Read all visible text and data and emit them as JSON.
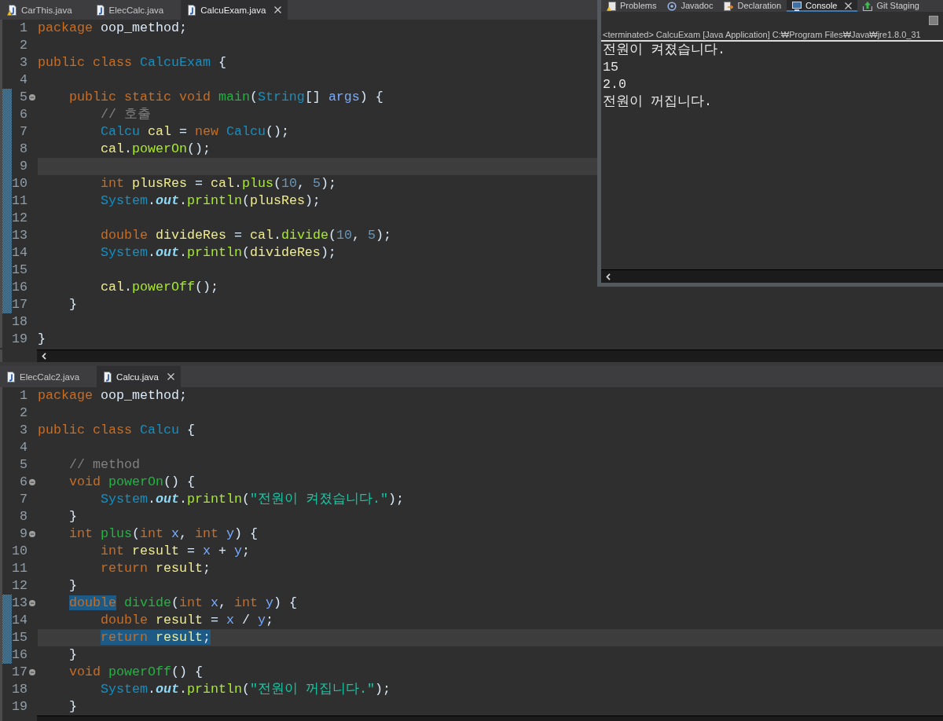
{
  "editors": [
    {
      "tabs": [
        {
          "label": "CarThis.java",
          "selected": false,
          "warning": true
        },
        {
          "label": "ElecCalc.java",
          "selected": false,
          "warning": false
        },
        {
          "label": "CalcuExam.java",
          "selected": true,
          "warning": false
        }
      ],
      "lines": [
        {
          "number": "1",
          "current": false,
          "changed": false,
          "foldable": false,
          "tokens": [
            {
              "kind": "keyword",
              "text": "package",
              "marked": false
            },
            {
              "kind": "plain",
              "text": " oop_method;",
              "marked": false
            }
          ]
        },
        {
          "number": "2",
          "current": false,
          "changed": false,
          "foldable": false
        },
        {
          "number": "3",
          "current": false,
          "changed": false,
          "foldable": false,
          "tokens": [
            {
              "kind": "keyword",
              "text": "public class",
              "marked": false
            },
            {
              "kind": "type",
              "text": " CalcuExam",
              "marked": false
            },
            {
              "kind": "plain",
              "text": " {",
              "marked": false
            }
          ]
        },
        {
          "number": "4",
          "current": false,
          "changed": false,
          "foldable": false
        },
        {
          "number": "5",
          "current": false,
          "changed": true,
          "foldable": true,
          "tokens": [
            {
              "kind": "keyword",
              "text": "    public static void",
              "marked": false
            },
            {
              "kind": "declaration",
              "text": " main",
              "marked": false
            },
            {
              "kind": "plain",
              "text": "(",
              "marked": false
            },
            {
              "kind": "type",
              "text": "String",
              "marked": false
            },
            {
              "kind": "plain",
              "text": "[] ",
              "marked": false
            },
            {
              "kind": "parameter",
              "text": "args",
              "marked": false
            },
            {
              "kind": "plain",
              "text": ") {",
              "marked": false
            }
          ]
        },
        {
          "number": "6",
          "current": false,
          "changed": true,
          "foldable": false,
          "tokens": [
            {
              "kind": "comment",
              "text": "        // 호출",
              "marked": false
            }
          ]
        },
        {
          "number": "7",
          "current": false,
          "changed": true,
          "foldable": false,
          "tokens": [
            {
              "kind": "type",
              "text": "        Calcu",
              "marked": false
            },
            {
              "kind": "variable",
              "text": " cal",
              "marked": false
            },
            {
              "kind": "plain",
              "text": " = ",
              "marked": false
            },
            {
              "kind": "keyword",
              "text": "new",
              "marked": false
            },
            {
              "kind": "type",
              "text": " Calcu",
              "marked": false
            },
            {
              "kind": "plain",
              "text": "();",
              "marked": false
            }
          ]
        },
        {
          "number": "8",
          "current": false,
          "changed": true,
          "foldable": false,
          "tokens": [
            {
              "kind": "variable",
              "text": "        cal",
              "marked": false
            },
            {
              "kind": "plain",
              "text": ".",
              "marked": false
            },
            {
              "kind": "call",
              "text": "powerOn",
              "marked": false
            },
            {
              "kind": "plain",
              "text": "();",
              "marked": false
            }
          ]
        },
        {
          "number": "9",
          "current": true,
          "changed": true,
          "foldable": false
        },
        {
          "number": "10",
          "current": false,
          "changed": true,
          "foldable": false,
          "tokens": [
            {
              "kind": "keyword",
              "text": "        int",
              "marked": false
            },
            {
              "kind": "variable",
              "text": " plusRes",
              "marked": false
            },
            {
              "kind": "plain",
              "text": " = ",
              "marked": false
            },
            {
              "kind": "variable",
              "text": "cal",
              "marked": false
            },
            {
              "kind": "plain",
              "text": ".",
              "marked": false
            },
            {
              "kind": "call",
              "text": "plus",
              "marked": false
            },
            {
              "kind": "plain",
              "text": "(",
              "marked": false
            },
            {
              "kind": "number",
              "text": "10",
              "marked": false
            },
            {
              "kind": "plain",
              "text": ", ",
              "marked": false
            },
            {
              "kind": "number",
              "text": "5",
              "marked": false
            },
            {
              "kind": "plain",
              "text": ");",
              "marked": false
            }
          ]
        },
        {
          "number": "11",
          "current": false,
          "changed": true,
          "foldable": false,
          "tokens": [
            {
              "kind": "type",
              "text": "        System",
              "marked": false
            },
            {
              "kind": "plain",
              "text": ".",
              "marked": false
            },
            {
              "kind": "field",
              "text": "out",
              "marked": false
            },
            {
              "kind": "plain",
              "text": ".",
              "marked": false
            },
            {
              "kind": "call",
              "text": "println",
              "marked": false
            },
            {
              "kind": "plain",
              "text": "(",
              "marked": false
            },
            {
              "kind": "variable",
              "text": "plusRes",
              "marked": false
            },
            {
              "kind": "plain",
              "text": ");",
              "marked": false
            }
          ]
        },
        {
          "number": "12",
          "current": false,
          "changed": true,
          "foldable": false
        },
        {
          "number": "13",
          "current": false,
          "changed": true,
          "foldable": false,
          "tokens": [
            {
              "kind": "keyword",
              "text": "        double",
              "marked": false
            },
            {
              "kind": "variable",
              "text": " divideRes",
              "marked": false
            },
            {
              "kind": "plain",
              "text": " = ",
              "marked": false
            },
            {
              "kind": "variable",
              "text": "cal",
              "marked": false
            },
            {
              "kind": "plain",
              "text": ".",
              "marked": false
            },
            {
              "kind": "call",
              "text": "divide",
              "marked": false
            },
            {
              "kind": "plain",
              "text": "(",
              "marked": false
            },
            {
              "kind": "number",
              "text": "10",
              "marked": false
            },
            {
              "kind": "plain",
              "text": ", ",
              "marked": false
            },
            {
              "kind": "number",
              "text": "5",
              "marked": false
            },
            {
              "kind": "plain",
              "text": ");",
              "marked": false
            }
          ]
        },
        {
          "number": "14",
          "current": false,
          "changed": true,
          "foldable": false,
          "tokens": [
            {
              "kind": "type",
              "text": "        System",
              "marked": false
            },
            {
              "kind": "plain",
              "text": ".",
              "marked": false
            },
            {
              "kind": "field",
              "text": "out",
              "marked": false
            },
            {
              "kind": "plain",
              "text": ".",
              "marked": false
            },
            {
              "kind": "call",
              "text": "println",
              "marked": false
            },
            {
              "kind": "plain",
              "text": "(",
              "marked": false
            },
            {
              "kind": "variable",
              "text": "divideRes",
              "marked": false
            },
            {
              "kind": "plain",
              "text": ");",
              "marked": false
            }
          ]
        },
        {
          "number": "15",
          "current": false,
          "changed": true,
          "foldable": false
        },
        {
          "number": "16",
          "current": false,
          "changed": true,
          "foldable": false,
          "tokens": [
            {
              "kind": "variable",
              "text": "        cal",
              "marked": false
            },
            {
              "kind": "plain",
              "text": ".",
              "marked": false
            },
            {
              "kind": "call",
              "text": "powerOff",
              "marked": false
            },
            {
              "kind": "plain",
              "text": "();",
              "marked": false
            }
          ]
        },
        {
          "number": "17",
          "current": false,
          "changed": true,
          "foldable": false,
          "tokens": [
            {
              "kind": "plain",
              "text": "    }",
              "marked": false
            }
          ]
        },
        {
          "number": "18",
          "current": false,
          "changed": false,
          "foldable": false
        },
        {
          "number": "19",
          "current": false,
          "changed": false,
          "foldable": false,
          "tokens": [
            {
              "kind": "plain",
              "text": "}",
              "marked": false
            }
          ]
        }
      ]
    },
    {
      "tabs": [
        {
          "label": "ElecCalc2.java",
          "selected": false,
          "warning": false
        },
        {
          "label": "Calcu.java",
          "selected": true,
          "warning": false
        }
      ],
      "lines": [
        {
          "number": "1",
          "current": false,
          "changed": false,
          "foldable": false,
          "tokens": [
            {
              "kind": "keyword",
              "text": "package",
              "marked": false
            },
            {
              "kind": "plain",
              "text": " oop_method;",
              "marked": false
            }
          ]
        },
        {
          "number": "2",
          "current": false,
          "changed": false,
          "foldable": false
        },
        {
          "number": "3",
          "current": false,
          "changed": false,
          "foldable": false,
          "tokens": [
            {
              "kind": "keyword",
              "text": "public class",
              "marked": false
            },
            {
              "kind": "type",
              "text": " Calcu",
              "marked": false
            },
            {
              "kind": "plain",
              "text": " {",
              "marked": false
            }
          ]
        },
        {
          "number": "4",
          "current": false,
          "changed": false,
          "foldable": false
        },
        {
          "number": "5",
          "current": false,
          "changed": false,
          "foldable": false,
          "tokens": [
            {
              "kind": "comment",
              "text": "    // method",
              "marked": false
            }
          ]
        },
        {
          "number": "6",
          "current": false,
          "changed": false,
          "foldable": true,
          "tokens": [
            {
              "kind": "keyword",
              "text": "    void",
              "marked": false
            },
            {
              "kind": "declaration",
              "text": " powerOn",
              "marked": false
            },
            {
              "kind": "plain",
              "text": "() {",
              "marked": false
            }
          ]
        },
        {
          "number": "7",
          "current": false,
          "changed": false,
          "foldable": false,
          "tokens": [
            {
              "kind": "type",
              "text": "        System",
              "marked": false
            },
            {
              "kind": "plain",
              "text": ".",
              "marked": false
            },
            {
              "kind": "field",
              "text": "out",
              "marked": false
            },
            {
              "kind": "plain",
              "text": ".",
              "marked": false
            },
            {
              "kind": "call",
              "text": "println",
              "marked": false
            },
            {
              "kind": "plain",
              "text": "(",
              "marked": false
            },
            {
              "kind": "string",
              "text": "\"전원이 켜졌습니다.\"",
              "marked": false
            },
            {
              "kind": "plain",
              "text": ");",
              "marked": false
            }
          ]
        },
        {
          "number": "8",
          "current": false,
          "changed": false,
          "foldable": false,
          "tokens": [
            {
              "kind": "plain",
              "text": "    }",
              "marked": false
            }
          ]
        },
        {
          "number": "9",
          "current": false,
          "changed": false,
          "foldable": true,
          "tokens": [
            {
              "kind": "keyword",
              "text": "    int",
              "marked": false
            },
            {
              "kind": "declaration",
              "text": " plus",
              "marked": false
            },
            {
              "kind": "plain",
              "text": "(",
              "marked": false
            },
            {
              "kind": "keyword",
              "text": "int",
              "marked": false
            },
            {
              "kind": "parameter",
              "text": " x",
              "marked": false
            },
            {
              "kind": "plain",
              "text": ", ",
              "marked": false
            },
            {
              "kind": "keyword",
              "text": "int",
              "marked": false
            },
            {
              "kind": "parameter",
              "text": " y",
              "marked": false
            },
            {
              "kind": "plain",
              "text": ") {",
              "marked": false
            }
          ]
        },
        {
          "number": "10",
          "current": false,
          "changed": false,
          "foldable": false,
          "tokens": [
            {
              "kind": "keyword",
              "text": "        int",
              "marked": false
            },
            {
              "kind": "variable",
              "text": " result",
              "marked": false
            },
            {
              "kind": "plain",
              "text": " = ",
              "marked": false
            },
            {
              "kind": "parameter",
              "text": "x",
              "marked": false
            },
            {
              "kind": "plain",
              "text": " + ",
              "marked": false
            },
            {
              "kind": "parameter",
              "text": "y",
              "marked": false
            },
            {
              "kind": "plain",
              "text": ";",
              "marked": false
            }
          ]
        },
        {
          "number": "11",
          "current": false,
          "changed": false,
          "foldable": false,
          "tokens": [
            {
              "kind": "keyword",
              "text": "        return",
              "marked": false
            },
            {
              "kind": "variable",
              "text": " result",
              "marked": false
            },
            {
              "kind": "plain",
              "text": ";",
              "marked": false
            }
          ]
        },
        {
          "number": "12",
          "current": false,
          "changed": false,
          "foldable": false,
          "tokens": [
            {
              "kind": "plain",
              "text": "    }",
              "marked": false
            }
          ]
        },
        {
          "number": "13",
          "current": false,
          "changed": true,
          "foldable": true,
          "tokens": [
            {
              "kind": "keyword",
              "text": "    double",
              "marked": true
            },
            {
              "kind": "declaration",
              "text": " divide",
              "marked": false
            },
            {
              "kind": "plain",
              "text": "(",
              "marked": false
            },
            {
              "kind": "keyword",
              "text": "int",
              "marked": false
            },
            {
              "kind": "parameter",
              "text": " x",
              "marked": false
            },
            {
              "kind": "plain",
              "text": ", ",
              "marked": false
            },
            {
              "kind": "keyword",
              "text": "int",
              "marked": false
            },
            {
              "kind": "parameter",
              "text": " y",
              "marked": false
            },
            {
              "kind": "plain",
              "text": ") {",
              "marked": false
            }
          ]
        },
        {
          "number": "14",
          "current": false,
          "changed": true,
          "foldable": false,
          "tokens": [
            {
              "kind": "keyword",
              "text": "        double",
              "marked": false
            },
            {
              "kind": "variable",
              "text": " result",
              "marked": false
            },
            {
              "kind": "plain",
              "text": " = ",
              "marked": false
            },
            {
              "kind": "parameter",
              "text": "x",
              "marked": false
            },
            {
              "kind": "plain",
              "text": " / ",
              "marked": false
            },
            {
              "kind": "parameter",
              "text": "y",
              "marked": false
            },
            {
              "kind": "plain",
              "text": ";",
              "marked": false
            }
          ]
        },
        {
          "number": "15",
          "current": true,
          "changed": true,
          "foldable": false,
          "tokens": [
            {
              "kind": "keyword",
              "text": "        return",
              "marked": true
            },
            {
              "kind": "variable",
              "text": " result",
              "marked": true
            },
            {
              "kind": "plain",
              "text": ";",
              "marked": true
            }
          ]
        },
        {
          "number": "16",
          "current": false,
          "changed": true,
          "foldable": false,
          "tokens": [
            {
              "kind": "plain",
              "text": "    }",
              "marked": false
            }
          ]
        },
        {
          "number": "17",
          "current": false,
          "changed": false,
          "foldable": true,
          "tokens": [
            {
              "kind": "keyword",
              "text": "    void",
              "marked": false
            },
            {
              "kind": "declaration",
              "text": " powerOff",
              "marked": false
            },
            {
              "kind": "plain",
              "text": "() {",
              "marked": false
            }
          ]
        },
        {
          "number": "18",
          "current": false,
          "changed": false,
          "foldable": false,
          "tokens": [
            {
              "kind": "type",
              "text": "        System",
              "marked": false
            },
            {
              "kind": "plain",
              "text": ".",
              "marked": false
            },
            {
              "kind": "field",
              "text": "out",
              "marked": false
            },
            {
              "kind": "plain",
              "text": ".",
              "marked": false
            },
            {
              "kind": "call",
              "text": "println",
              "marked": false
            },
            {
              "kind": "plain",
              "text": "(",
              "marked": false
            },
            {
              "kind": "string",
              "text": "\"전원이 꺼집니다.\"",
              "marked": false
            },
            {
              "kind": "plain",
              "text": ");",
              "marked": false
            }
          ]
        },
        {
          "number": "19",
          "current": false,
          "changed": false,
          "foldable": false,
          "tokens": [
            {
              "kind": "plain",
              "text": "    }",
              "marked": false
            }
          ]
        }
      ]
    }
  ],
  "console": {
    "tabs": [
      {
        "label": "Problems",
        "kind": "problems",
        "selected": false
      },
      {
        "label": "Javadoc",
        "kind": "javadoc",
        "selected": false
      },
      {
        "label": "Declaration",
        "kind": "declaration",
        "selected": false
      },
      {
        "label": "Console",
        "kind": "console",
        "selected": true
      },
      {
        "label": "Git Staging",
        "kind": "git",
        "selected": false
      }
    ],
    "stop_button": {
      "disabled": true
    },
    "process": "<terminated> CalcuExam [Java Application] C:₩Program Files₩Java₩jre1.8.0_31",
    "output": [
      "전원이 켜졌습니다.",
      "15",
      "2.0",
      "전원이 꺼집니다."
    ]
  }
}
